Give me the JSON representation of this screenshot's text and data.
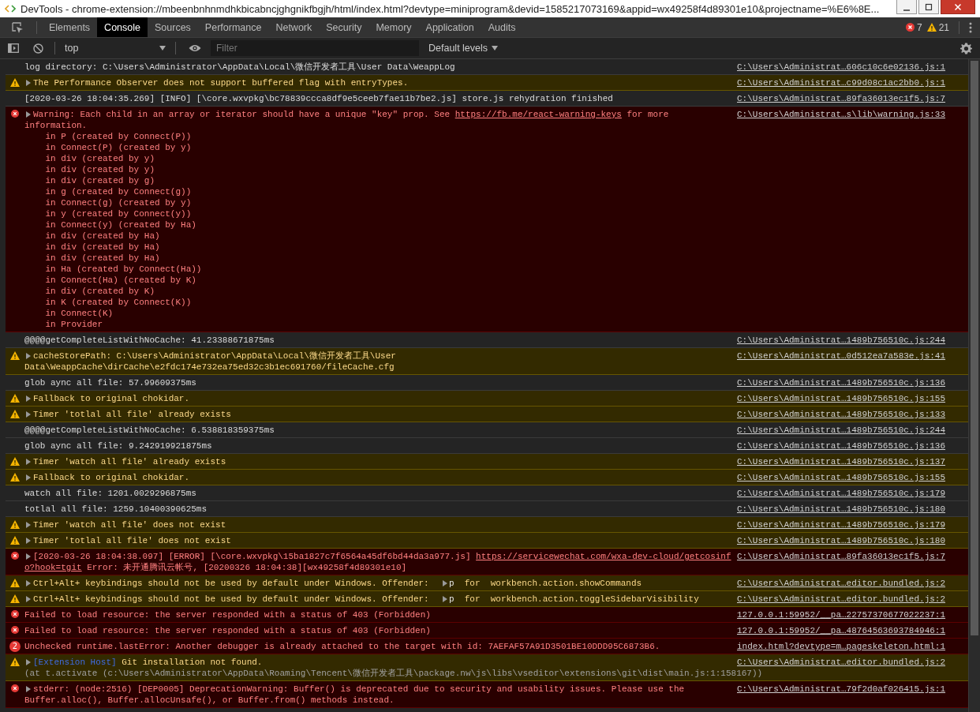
{
  "title_bar": {
    "title": "DevTools - chrome-extension://mbeenbnhnmdhkbicabncjghgnikfbgjh/html/index.html?devtype=miniprogram&devid=1585217073169&appid=wx49258f4d89301e10&projectname=%E6%8E..."
  },
  "tabs": [
    {
      "label": "Elements",
      "selected": false
    },
    {
      "label": "Console",
      "selected": true
    },
    {
      "label": "Sources",
      "selected": false
    },
    {
      "label": "Performance",
      "selected": false
    },
    {
      "label": "Network",
      "selected": false
    },
    {
      "label": "Security",
      "selected": false
    },
    {
      "label": "Memory",
      "selected": false
    },
    {
      "label": "Application",
      "selected": false
    },
    {
      "label": "Audits",
      "selected": false
    }
  ],
  "counters": {
    "errors": "7",
    "warnings": "21"
  },
  "toolbar": {
    "context": "top",
    "filter_placeholder": "Filter",
    "levels": "Default levels"
  },
  "messages": [
    {
      "kind": "log",
      "expandable": false,
      "lines": [
        [
          {
            "kind": "text",
            "text": "log directory: C:\\Users\\Administrator\\AppData\\Local\\微信开发者工具\\User Data\\WeappLog"
          }
        ]
      ],
      "source": "C:\\Users\\Administrat…606c10c6e02136.js:1"
    },
    {
      "kind": "warning",
      "expandable": true,
      "lines": [
        [
          {
            "kind": "text",
            "text": "The Performance Observer does not support buffered flag with entryTypes."
          }
        ]
      ],
      "source": "C:\\Users\\Administrat…c99d08c1ac2bb0.js:1"
    },
    {
      "kind": "log",
      "expandable": false,
      "lines": [
        [
          {
            "kind": "text",
            "text": "[2020-03-26 18:04:35.269] [INFO] [\\core.wxvpkg\\bc78839ccca8df9e5ceeb7fae11b7be2.js] store.js rehydration finished"
          }
        ]
      ],
      "source": "C:\\Users\\Administrat…89fa36013ec1f5.js:7"
    },
    {
      "kind": "error",
      "expandable": true,
      "lines": [
        [
          {
            "kind": "text",
            "text": "Warning: Each child in an array or iterator should have a unique \"key\" prop. See "
          },
          {
            "kind": "link",
            "text": "https://fb.me/react-warning-keys"
          },
          {
            "kind": "text",
            "text": " for more"
          }
        ],
        [
          {
            "kind": "text",
            "text": "information."
          }
        ],
        [
          {
            "kind": "text",
            "text": "    in P (created by Connect(P))"
          }
        ],
        [
          {
            "kind": "text",
            "text": "    in Connect(P) (created by y)"
          }
        ],
        [
          {
            "kind": "text",
            "text": "    in div (created by y)"
          }
        ],
        [
          {
            "kind": "text",
            "text": "    in div (created by y)"
          }
        ],
        [
          {
            "kind": "text",
            "text": "    in div (created by g)"
          }
        ],
        [
          {
            "kind": "text",
            "text": "    in g (created by Connect(g))"
          }
        ],
        [
          {
            "kind": "text",
            "text": "    in Connect(g) (created by y)"
          }
        ],
        [
          {
            "kind": "text",
            "text": "    in y (created by Connect(y))"
          }
        ],
        [
          {
            "kind": "text",
            "text": "    in Connect(y) (created by Ha)"
          }
        ],
        [
          {
            "kind": "text",
            "text": "    in div (created by Ha)"
          }
        ],
        [
          {
            "kind": "text",
            "text": "    in div (created by Ha)"
          }
        ],
        [
          {
            "kind": "text",
            "text": "    in div (created by Ha)"
          }
        ],
        [
          {
            "kind": "text",
            "text": "    in Ha (created by Connect(Ha))"
          }
        ],
        [
          {
            "kind": "text",
            "text": "    in Connect(Ha) (created by K)"
          }
        ],
        [
          {
            "kind": "text",
            "text": "    in div (created by K)"
          }
        ],
        [
          {
            "kind": "text",
            "text": "    in K (created by Connect(K))"
          }
        ],
        [
          {
            "kind": "text",
            "text": "    in Connect(K)"
          }
        ],
        [
          {
            "kind": "text",
            "text": "    in Provider"
          }
        ]
      ],
      "source": "C:\\Users\\Administrat…s\\lib\\warning.js:33"
    },
    {
      "kind": "log",
      "expandable": false,
      "lines": [
        [
          {
            "kind": "text",
            "text": "@@@@getCompleteListWithNoCache: 41.23388671875ms"
          }
        ]
      ],
      "source": "C:\\Users\\Administrat…1489b756510c.js:244"
    },
    {
      "kind": "warning",
      "expandable": true,
      "lines": [
        [
          {
            "kind": "text",
            "text": "cacheStorePath: C:\\Users\\Administrator\\AppData\\Local\\微信开发者工具\\User"
          }
        ],
        [
          {
            "kind": "text",
            "text": "Data\\WeappCache\\dirCache\\e2fdc174e732ea75ed32c3b1ec691760/fileCache.cfg"
          }
        ]
      ],
      "source": "C:\\Users\\Administrat…0d512ea7a583e.js:41"
    },
    {
      "kind": "log",
      "expandable": false,
      "lines": [
        [
          {
            "kind": "text",
            "text": "glob aync all file: 57.99609375ms"
          }
        ]
      ],
      "source": "C:\\Users\\Administrat…1489b756510c.js:136"
    },
    {
      "kind": "warning",
      "expandable": true,
      "lines": [
        [
          {
            "kind": "text",
            "text": "Fallback to original chokidar."
          }
        ]
      ],
      "source": "C:\\Users\\Administrat…1489b756510c.js:155"
    },
    {
      "kind": "warning",
      "expandable": true,
      "lines": [
        [
          {
            "kind": "text",
            "text": "Timer 'totlal all file' already exists"
          }
        ]
      ],
      "source": "C:\\Users\\Administrat…1489b756510c.js:133"
    },
    {
      "kind": "log",
      "expandable": false,
      "lines": [
        [
          {
            "kind": "text",
            "text": "@@@@getCompleteListWithNoCache: 6.538818359375ms"
          }
        ]
      ],
      "source": "C:\\Users\\Administrat…1489b756510c.js:244"
    },
    {
      "kind": "log",
      "expandable": false,
      "lines": [
        [
          {
            "kind": "text",
            "text": "glob aync all file: 9.242919921875ms"
          }
        ]
      ],
      "source": "C:\\Users\\Administrat…1489b756510c.js:136"
    },
    {
      "kind": "warning",
      "expandable": true,
      "lines": [
        [
          {
            "kind": "text",
            "text": "Timer 'watch all file' already exists"
          }
        ]
      ],
      "source": "C:\\Users\\Administrat…1489b756510c.js:137"
    },
    {
      "kind": "warning",
      "expandable": true,
      "lines": [
        [
          {
            "kind": "text",
            "text": "Fallback to original chokidar."
          }
        ]
      ],
      "source": "C:\\Users\\Administrat…1489b756510c.js:155"
    },
    {
      "kind": "log",
      "expandable": false,
      "lines": [
        [
          {
            "kind": "text",
            "text": "watch all file: 1201.0029296875ms"
          }
        ]
      ],
      "source": "C:\\Users\\Administrat…1489b756510c.js:179"
    },
    {
      "kind": "log",
      "expandable": false,
      "lines": [
        [
          {
            "kind": "text",
            "text": "totlal all file: 1259.10400390625ms"
          }
        ]
      ],
      "source": "C:\\Users\\Administrat…1489b756510c.js:180"
    },
    {
      "kind": "warning",
      "expandable": true,
      "lines": [
        [
          {
            "kind": "text",
            "text": "Timer 'watch all file' does not exist"
          }
        ]
      ],
      "source": "C:\\Users\\Administrat…1489b756510c.js:179"
    },
    {
      "kind": "warning",
      "expandable": true,
      "lines": [
        [
          {
            "kind": "text",
            "text": "Timer 'totlal all file' does not exist"
          }
        ]
      ],
      "source": "C:\\Users\\Administrat…1489b756510c.js:180"
    },
    {
      "kind": "error",
      "expandable": true,
      "lines": [
        [
          {
            "kind": "text",
            "text": "[2020-03-26 18:04:38.097] [ERROR] [\\core.wxvpkg\\15ba1827c7f6564a45df6bd44da3a977.js] "
          },
          {
            "kind": "link",
            "text": "https://servicewechat.com/wxa-dev-cloud/getcosinf"
          }
        ],
        [
          {
            "kind": "link",
            "text": "o?hook=tgit"
          },
          {
            "kind": "text",
            "text": " Error: 未开通腾讯云帐号, [20200326 18:04:38][wx49258f4d89301e10]"
          }
        ]
      ],
      "source": "C:\\Users\\Administrat…89fa36013ec1f5.js:7"
    },
    {
      "kind": "warning",
      "expandable": true,
      "lines": [
        [
          {
            "kind": "text",
            "text": "Ctrl+Alt+ keybindings should not be used by default under Windows. Offender:  "
          },
          {
            "kind": "object",
            "text": "p"
          },
          {
            "kind": "text",
            "text": "  for  workbench.action.showCommands"
          }
        ]
      ],
      "source": "C:\\Users\\Administrat…editor.bundled.js:2"
    },
    {
      "kind": "warning",
      "expandable": true,
      "lines": [
        [
          {
            "kind": "text",
            "text": "Ctrl+Alt+ keybindings should not be used by default under Windows. Offender:  "
          },
          {
            "kind": "object",
            "text": "p"
          },
          {
            "kind": "text",
            "text": "  for  workbench.action.toggleSidebarVisibility"
          }
        ]
      ],
      "source": "C:\\Users\\Administrat…editor.bundled.js:2"
    },
    {
      "kind": "error",
      "expandable": false,
      "lines": [
        [
          {
            "kind": "text",
            "text": "Failed to load resource: the server responded with a status of 403 (Forbidden)"
          }
        ]
      ],
      "source": "127.0.0.1:59952/__pa…22757370677022237:1"
    },
    {
      "kind": "error",
      "expandable": false,
      "lines": [
        [
          {
            "kind": "text",
            "text": "Failed to load resource: the server responded with a status of 403 (Forbidden)"
          }
        ]
      ],
      "source": "127.0.0.1:59952/__pa…48764563693784946:1"
    },
    {
      "kind": "error",
      "expandable": false,
      "count": "2",
      "lines": [
        [
          {
            "kind": "text",
            "text": "Unchecked runtime.lastError: Another debugger is already attached to the target with id: 7AEFAF57A91D3501BE10DDD95C6873B6."
          }
        ]
      ],
      "source": "index.html?devtype=m…pageskeleton.html:1"
    },
    {
      "kind": "warning",
      "expandable": true,
      "lines": [
        [
          {
            "kind": "tag",
            "text": "[Extension Host]"
          },
          {
            "kind": "text",
            "text": " Git installation not found."
          }
        ],
        [
          {
            "kind": "muted",
            "text": "(at t.activate (c:\\Users\\Administrator\\AppData\\Roaming\\Tencent\\微信开发者工具\\package.nw\\js\\libs\\vseditor\\extensions\\git\\dist\\main.js:1:158167))"
          }
        ]
      ],
      "source": "C:\\Users\\Administrat…editor.bundled.js:2"
    },
    {
      "kind": "error",
      "expandable": true,
      "lines": [
        [
          {
            "kind": "text",
            "text": "stderr: (node:2516) [DEP0005] DeprecationWarning: Buffer() is deprecated due to security and usability issues. Please use the"
          }
        ],
        [
          {
            "kind": "text",
            "text": "Buffer.alloc(), Buffer.allocUnsafe(), or Buffer.from() methods instead."
          }
        ]
      ],
      "source": "C:\\Users\\Administrat…79f2d0af026415.js:1"
    }
  ]
}
